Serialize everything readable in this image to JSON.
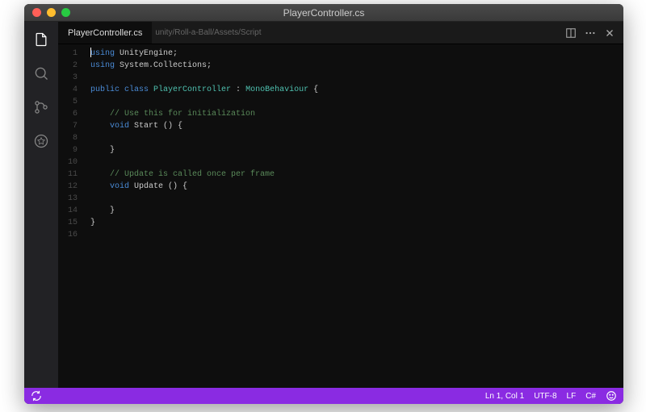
{
  "window": {
    "title": "PlayerController.cs"
  },
  "tab": {
    "filename": "PlayerController.cs",
    "breadcrumb": "unity/Roll-a-Ball/Assets/Script"
  },
  "code": {
    "lines": [
      {
        "n": 1,
        "tokens": [
          {
            "t": "cursor"
          },
          {
            "t": "kw",
            "v": "using"
          },
          {
            "t": "p",
            "v": " UnityEngine;"
          }
        ]
      },
      {
        "n": 2,
        "tokens": [
          {
            "t": "kw",
            "v": "using"
          },
          {
            "t": "p",
            "v": " System.Collections;"
          }
        ]
      },
      {
        "n": 3,
        "tokens": []
      },
      {
        "n": 4,
        "tokens": [
          {
            "t": "kw",
            "v": "public class"
          },
          {
            "t": "p",
            "v": " "
          },
          {
            "t": "type",
            "v": "PlayerController"
          },
          {
            "t": "p",
            "v": " : "
          },
          {
            "t": "type",
            "v": "MonoBehaviour"
          },
          {
            "t": "p",
            "v": " {"
          }
        ]
      },
      {
        "n": 5,
        "tokens": []
      },
      {
        "n": 6,
        "tokens": [
          {
            "t": "p",
            "v": "    "
          },
          {
            "t": "comment",
            "v": "// Use this for initialization"
          }
        ]
      },
      {
        "n": 7,
        "tokens": [
          {
            "t": "p",
            "v": "    "
          },
          {
            "t": "kw",
            "v": "void"
          },
          {
            "t": "p",
            "v": " Start () {"
          }
        ]
      },
      {
        "n": 8,
        "tokens": []
      },
      {
        "n": 9,
        "tokens": [
          {
            "t": "p",
            "v": "    }"
          }
        ]
      },
      {
        "n": 10,
        "tokens": []
      },
      {
        "n": 11,
        "tokens": [
          {
            "t": "p",
            "v": "    "
          },
          {
            "t": "comment",
            "v": "// Update is called once per frame"
          }
        ]
      },
      {
        "n": 12,
        "tokens": [
          {
            "t": "p",
            "v": "    "
          },
          {
            "t": "kw",
            "v": "void"
          },
          {
            "t": "p",
            "v": " Update () {"
          }
        ]
      },
      {
        "n": 13,
        "tokens": []
      },
      {
        "n": 14,
        "tokens": [
          {
            "t": "p",
            "v": "    }"
          }
        ]
      },
      {
        "n": 15,
        "tokens": [
          {
            "t": "p",
            "v": "}"
          }
        ]
      },
      {
        "n": 16,
        "tokens": []
      }
    ]
  },
  "statusbar": {
    "position": "Ln 1, Col 1",
    "encoding": "UTF-8",
    "eol": "LF",
    "language": "C#"
  }
}
